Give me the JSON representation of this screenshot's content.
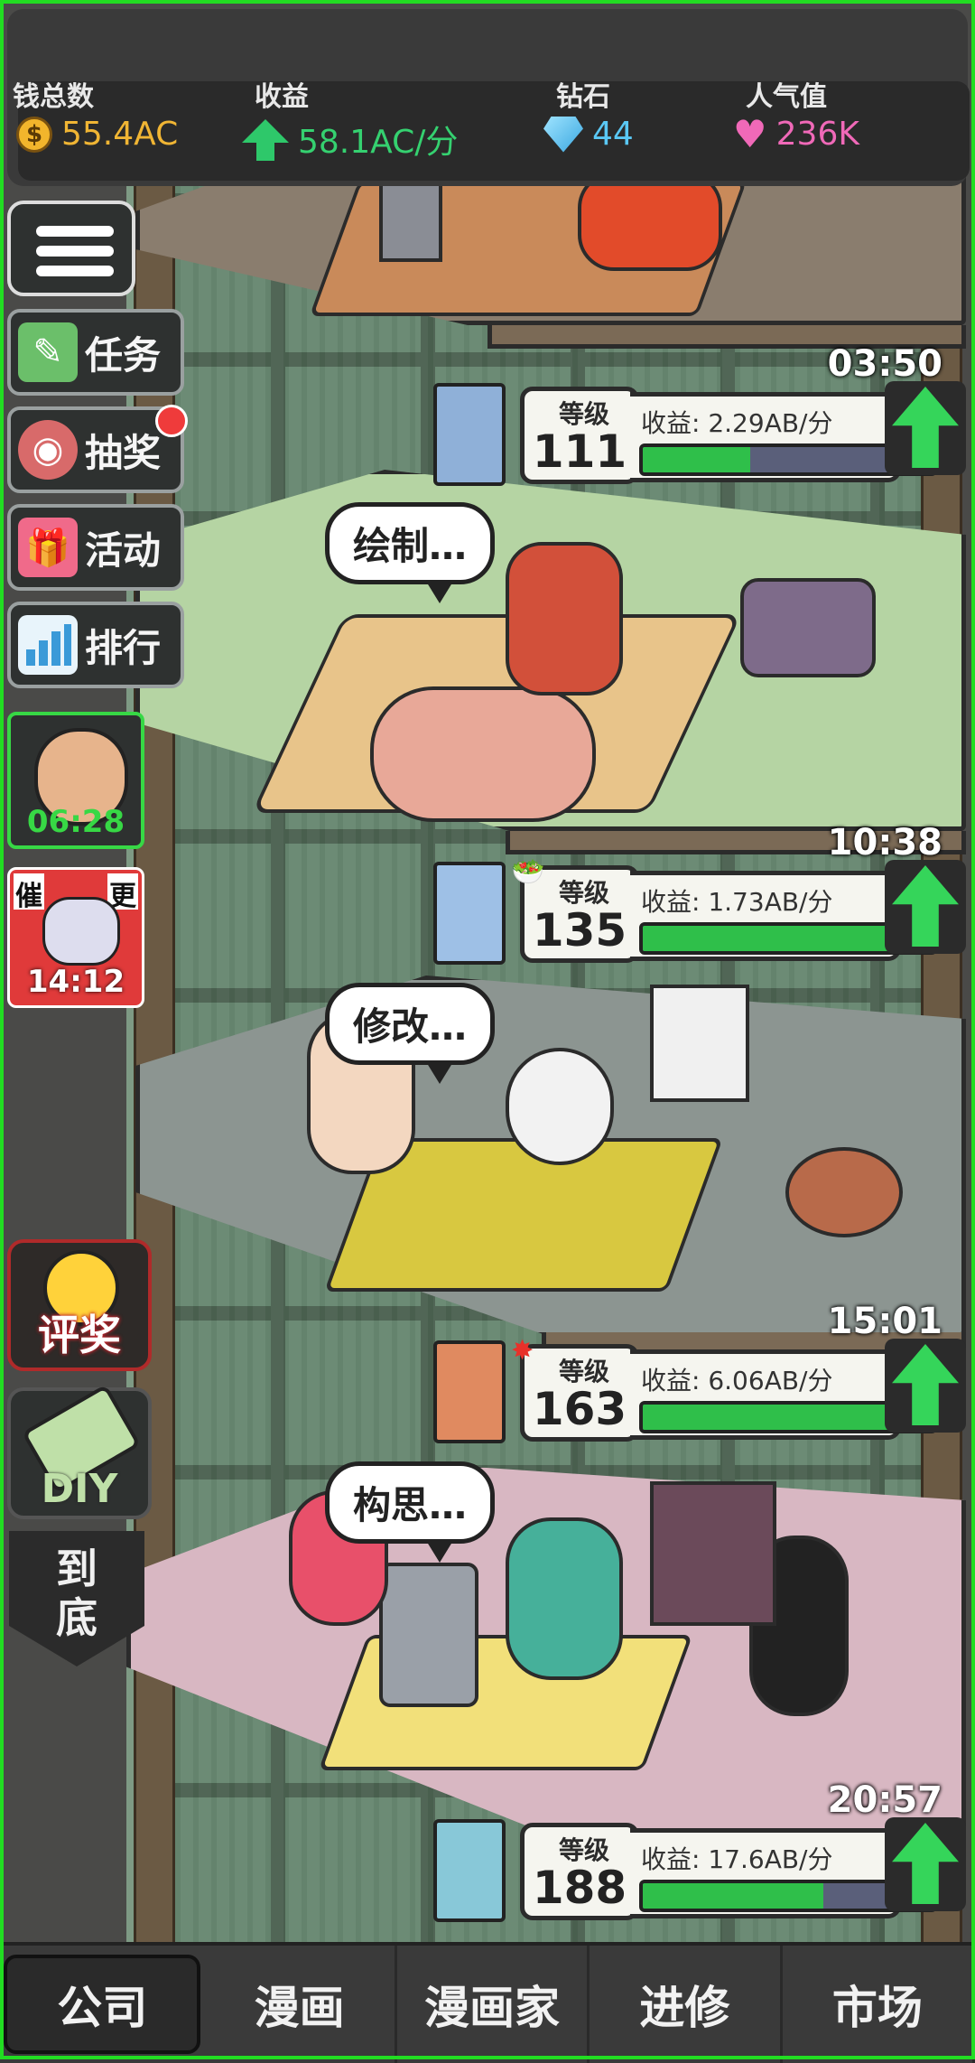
{
  "stats": {
    "money_label": "钱总数",
    "money_value": "55.4AC",
    "income_label": "收益",
    "income_value": "58.1AC/分",
    "diamond_label": "钻石",
    "diamond_value": "44",
    "popularity_label": "人气值",
    "popularity_value": "236K",
    "coin_glyph": "$",
    "colors": {
      "money": "#f0b534",
      "income": "#35d170",
      "diamond": "#5ac8f5",
      "popularity": "#f069b8"
    }
  },
  "sidebar": {
    "menu_icon": "menu-list-icon",
    "items": [
      {
        "label": "任务",
        "icon": "clipboard-icon"
      },
      {
        "label": "抽奖",
        "icon": "lottery-icon"
      },
      {
        "label": "活动",
        "icon": "gift-icon"
      },
      {
        "label": "排行",
        "icon": "bar-chart-icon"
      }
    ],
    "timer_cards": [
      {
        "time": "06:28",
        "icon": "character-portrait-icon"
      },
      {
        "time": "14:12",
        "icon": "urge-update-icon",
        "tag_left": "催",
        "tag_right": "更"
      }
    ],
    "award_label": "评奖",
    "diy_label": "DIY",
    "to_bottom_line1": "到",
    "to_bottom_line2": "底"
  },
  "floors": [
    {
      "timer": "03:50",
      "level_label": "等级",
      "level": "111",
      "income_label": "收益:",
      "income": "2.29AB/分",
      "progress": 0.37,
      "bubble": "",
      "portrait_color": "#8fb0d8"
    },
    {
      "timer": "10:38",
      "level_label": "等级",
      "level": "135",
      "income_label": "收益:",
      "income": "1.73AB/分",
      "progress": 1.0,
      "bubble": "绘制…",
      "portrait_color": "#9ec0e6"
    },
    {
      "timer": "15:01",
      "level_label": "等级",
      "level": "163",
      "income_label": "收益:",
      "income": "6.06AB/分",
      "progress": 0.93,
      "bubble": "修改…",
      "portrait_color": "#e08a60"
    },
    {
      "timer": "20:57",
      "level_label": "等级",
      "level": "188",
      "income_label": "收益:",
      "income": "17.6AB/分",
      "progress": 0.62,
      "bubble": "构思…",
      "portrait_color": "#88c8d8"
    }
  ],
  "bottom_nav": [
    {
      "label": "公司",
      "active": true
    },
    {
      "label": "漫画",
      "active": false
    },
    {
      "label": "漫画家",
      "active": false
    },
    {
      "label": "进修",
      "active": false
    },
    {
      "label": "市场",
      "active": false
    }
  ]
}
